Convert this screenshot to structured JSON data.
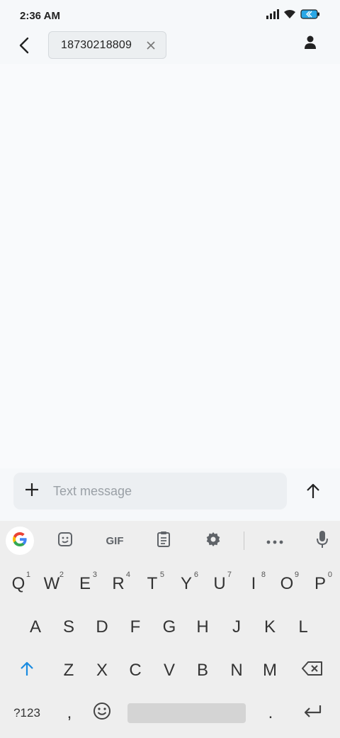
{
  "status": {
    "time": "2:36 AM",
    "icons": [
      "signal-icon",
      "wifi-icon",
      "battery-icon"
    ]
  },
  "header": {
    "back_icon": "back-arrow-icon",
    "recipient": "18730218809",
    "clear_icon": "close-icon",
    "contact_icon": "person-icon"
  },
  "compose": {
    "attach_icon": "plus-icon",
    "placeholder": "Text message",
    "send_icon": "send-arrow-icon"
  },
  "keyboard": {
    "toolbar": {
      "google_icon": "google-g-icon",
      "sticker_icon": "sticker-icon",
      "gif_label": "GIF",
      "clipboard_icon": "clipboard-icon",
      "settings_icon": "gear-icon",
      "more_icon": "more-icon",
      "mic_icon": "mic-icon"
    },
    "row1": [
      {
        "label": "Q",
        "hint": "1"
      },
      {
        "label": "W",
        "hint": "2"
      },
      {
        "label": "E",
        "hint": "3"
      },
      {
        "label": "R",
        "hint": "4"
      },
      {
        "label": "T",
        "hint": "5"
      },
      {
        "label": "Y",
        "hint": "6"
      },
      {
        "label": "U",
        "hint": "7"
      },
      {
        "label": "I",
        "hint": "8"
      },
      {
        "label": "O",
        "hint": "9"
      },
      {
        "label": "P",
        "hint": "0"
      }
    ],
    "row2": [
      "A",
      "S",
      "D",
      "F",
      "G",
      "H",
      "J",
      "K",
      "L"
    ],
    "row3": [
      "Z",
      "X",
      "C",
      "V",
      "B",
      "N",
      "M"
    ],
    "shift_icon": "shift-arrow-icon",
    "backspace_icon": "backspace-icon",
    "symbols_label": "?123",
    "comma_label": ",",
    "emoji_icon": "emoji-icon",
    "period_label": ".",
    "enter_icon": "enter-icon"
  }
}
